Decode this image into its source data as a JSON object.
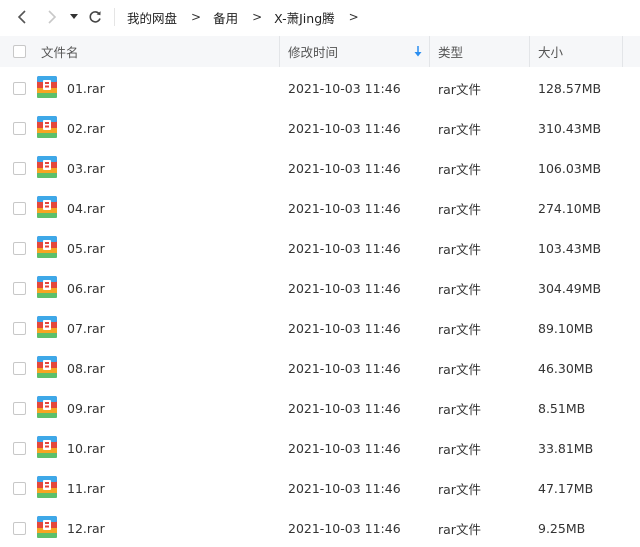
{
  "nav": {
    "back_icon": "chevron-left-icon",
    "forward_icon": "chevron-right-icon",
    "history_icon": "caret-down-icon",
    "refresh_icon": "refresh-icon",
    "breadcrumbs": [
      "我的网盘",
      "备用",
      "X-萧Jing腾"
    ],
    "separator": ">"
  },
  "table": {
    "headers": {
      "name": "文件名",
      "modified": "修改时间",
      "type": "类型",
      "size": "大小"
    },
    "sort_icon": "sort-down-arrow-icon",
    "sort_color": "#2b8ef0",
    "rows": [
      {
        "name": "01.rar",
        "modified": "2021-10-03 11:46",
        "type": "rar文件",
        "size": "128.57MB"
      },
      {
        "name": "02.rar",
        "modified": "2021-10-03 11:46",
        "type": "rar文件",
        "size": "310.43MB"
      },
      {
        "name": "03.rar",
        "modified": "2021-10-03 11:46",
        "type": "rar文件",
        "size": "106.03MB"
      },
      {
        "name": "04.rar",
        "modified": "2021-10-03 11:46",
        "type": "rar文件",
        "size": "274.10MB"
      },
      {
        "name": "05.rar",
        "modified": "2021-10-03 11:46",
        "type": "rar文件",
        "size": "103.43MB"
      },
      {
        "name": "06.rar",
        "modified": "2021-10-03 11:46",
        "type": "rar文件",
        "size": "304.49MB"
      },
      {
        "name": "07.rar",
        "modified": "2021-10-03 11:46",
        "type": "rar文件",
        "size": "89.10MB"
      },
      {
        "name": "08.rar",
        "modified": "2021-10-03 11:46",
        "type": "rar文件",
        "size": "46.30MB"
      },
      {
        "name": "09.rar",
        "modified": "2021-10-03 11:46",
        "type": "rar文件",
        "size": "8.51MB"
      },
      {
        "name": "10.rar",
        "modified": "2021-10-03 11:46",
        "type": "rar文件",
        "size": "33.81MB"
      },
      {
        "name": "11.rar",
        "modified": "2021-10-03 11:46",
        "type": "rar文件",
        "size": "47.17MB"
      },
      {
        "name": "12.rar",
        "modified": "2021-10-03 11:46",
        "type": "rar文件",
        "size": "9.25MB"
      }
    ]
  },
  "file_icon": "rar-archive-icon",
  "colors": {
    "header_bg": "#f6f7f9",
    "icon_blue": "#3ea8e8",
    "icon_green": "#5cc06a",
    "icon_orange": "#f5a623",
    "icon_red": "#e4473c",
    "icon_purple": "#8d5ccf"
  }
}
